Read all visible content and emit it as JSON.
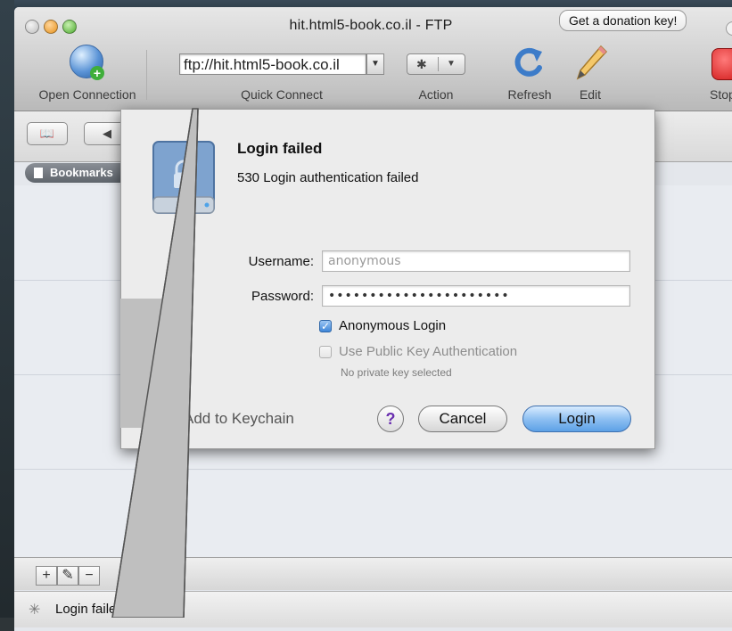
{
  "window": {
    "title": "hit.html5-book.co.il - FTP"
  },
  "donation": {
    "label": "Get a donation key!"
  },
  "toolbar": {
    "open_connection": "Open Connection",
    "quick_connect_value": "ftp://hit.html5-book.co.il",
    "quick_connect_label": "Quick Connect",
    "action_label": "Action",
    "refresh_label": "Refresh",
    "edit_label": "Edit",
    "stop_label": "Stop"
  },
  "browser": {
    "bookmarks_tab": "Bookmarks"
  },
  "dialog": {
    "title": "Login failed",
    "message": "530 Login authentication failed",
    "username_label": "Username:",
    "username_value": "anonymous",
    "password_label": "Password:",
    "password_value": "••••••••••••••••••••••",
    "anonymous_login": "Anonymous Login",
    "anonymous_checked": true,
    "public_key": "Use Public Key Authentication",
    "public_key_checked": false,
    "no_key": "No private key selected",
    "keychain": "Add to Keychain",
    "help": "?",
    "cancel": "Cancel",
    "login": "Login"
  },
  "status": {
    "text": "Login failed"
  },
  "colors": {
    "login_button": "#8fc0f2",
    "help_glyph": "#6a2fb0",
    "stop_icon": "#d01818"
  }
}
